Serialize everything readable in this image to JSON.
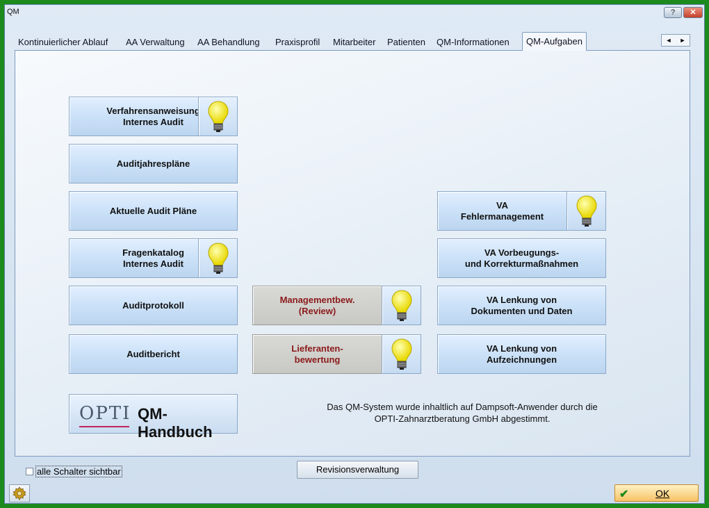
{
  "window": {
    "title": "QM",
    "help_label": "?",
    "close_label": "✕"
  },
  "tabs": [
    {
      "label": "Kontinuierlicher Ablauf"
    },
    {
      "label": "AA Verwaltung"
    },
    {
      "label": "AA  Behandlung"
    },
    {
      "label": "Praxisprofil"
    },
    {
      "label": "Mitarbeiter"
    },
    {
      "label": "Patienten"
    },
    {
      "label": "QM-Informationen"
    },
    {
      "label": "QM-Aufgaben",
      "active": true
    }
  ],
  "tab_scroll": {
    "left": "◄",
    "right": "►"
  },
  "column1": [
    {
      "label": "Verfahrensanweisung\nInternes Audit",
      "bulb": true
    },
    {
      "label": "Auditjahrespläne"
    },
    {
      "label": "Aktuelle Audit Pläne"
    },
    {
      "label": "Fragenkatalog\nInternes Audit",
      "bulb": true
    },
    {
      "label": "Auditprotokoll"
    },
    {
      "label": "Auditbericht"
    }
  ],
  "column2": [
    {
      "label": "Managementbew.\n(Review)",
      "bulb": true
    },
    {
      "label": "Lieferanten-\nbewertung",
      "bulb": true
    }
  ],
  "column3": [
    {
      "label": "VA\nFehlermanagement",
      "bulb": true
    },
    {
      "label": "VA Vorbeugungs-\nund Korrekturmaßnahmen"
    },
    {
      "label": "VA Lenkung von\nDokumenten und Daten"
    },
    {
      "label": "VA Lenkung von\nAufzeichnungen"
    }
  ],
  "logo": {
    "opti": "OPTI",
    "qm": "QM-Handbuch"
  },
  "info_text": "Das QM-System wurde inhaltlich auf Dampsoft-Anwender durch die\nOPTI-Zahnarztberatung GmbH abgestimmt.",
  "footer": {
    "checkbox_label": "alle Schalter sichtbar",
    "checkbox_checked": false,
    "revision_label": "Revisionsverwaltung",
    "ok_check": "✔",
    "ok_label": "OK"
  },
  "icons": [
    "lightbulb-icon",
    "gear-icon",
    "checkmark-icon"
  ]
}
